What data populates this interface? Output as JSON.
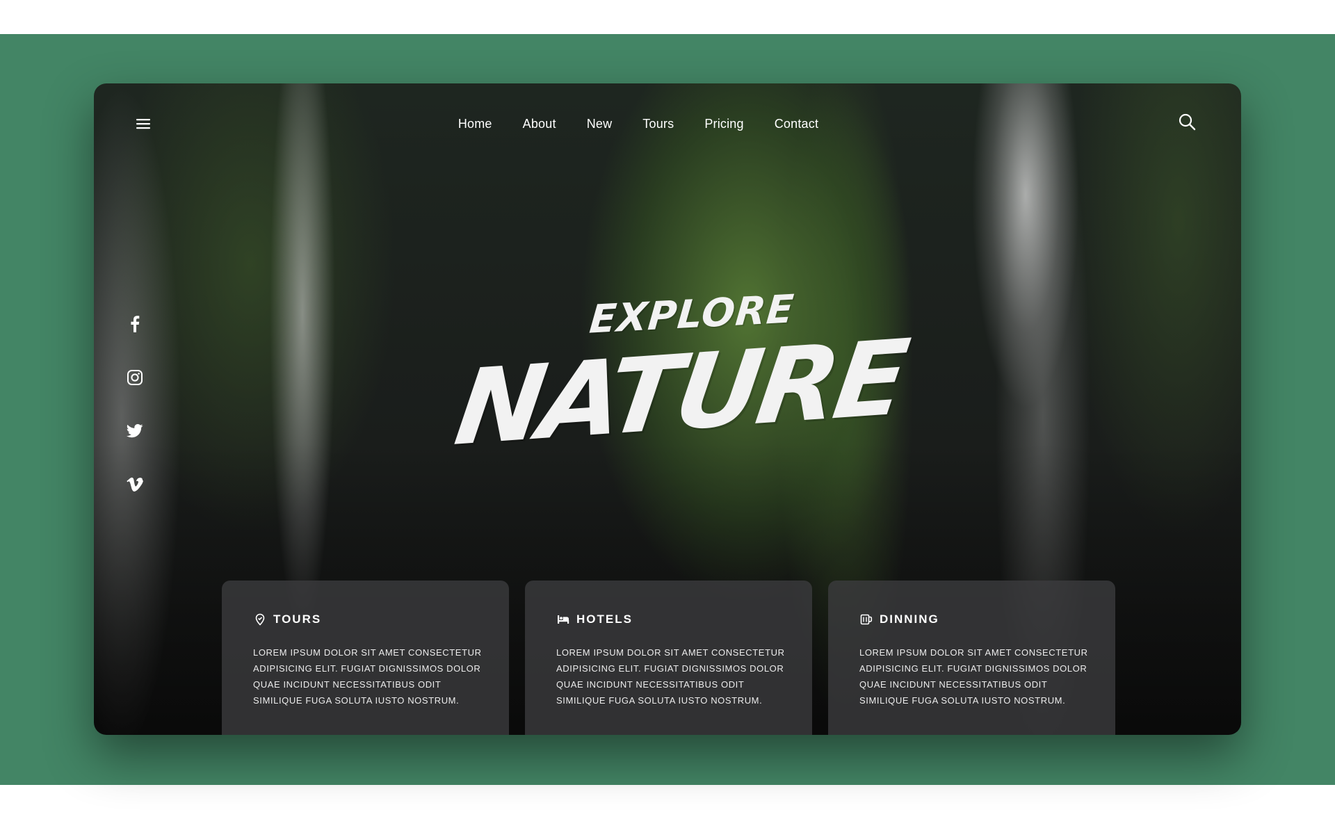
{
  "page": {
    "background_color": "#438565"
  },
  "header": {
    "menu_icon": "hamburger-menu-icon",
    "search_icon": "search-icon",
    "nav": [
      {
        "label": "Home"
      },
      {
        "label": "About"
      },
      {
        "label": "New"
      },
      {
        "label": "Tours"
      },
      {
        "label": "Pricing"
      },
      {
        "label": "Contact"
      }
    ]
  },
  "social": [
    {
      "icon": "facebook-icon"
    },
    {
      "icon": "instagram-icon"
    },
    {
      "icon": "twitter-icon"
    },
    {
      "icon": "vimeo-icon"
    }
  ],
  "hero": {
    "title_small": "EXPLORE",
    "title_big": "NATURE"
  },
  "cards": [
    {
      "icon": "location-pin-icon",
      "title": "TOURS",
      "text": "LOREM IPSUM DOLOR SIT AMET CONSECTETUR ADIPISICING ELIT. FUGIAT DIGNISSIMOS DOLOR QUAE INCIDUNT NECESSITATIBUS ODIT SIMILIQUE FUGA SOLUTA IUSTO NOSTRUM."
    },
    {
      "icon": "bed-icon",
      "title": "HOTELS",
      "text": "LOREM IPSUM DOLOR SIT AMET CONSECTETUR ADIPISICING ELIT. FUGIAT DIGNISSIMOS DOLOR QUAE INCIDUNT NECESSITATIBUS ODIT SIMILIQUE FUGA SOLUTA IUSTO NOSTRUM."
    },
    {
      "icon": "mug-icon",
      "title": "DINNING",
      "text": "LOREM IPSUM DOLOR SIT AMET CONSECTETUR ADIPISICING ELIT. FUGIAT DIGNISSIMOS DOLOR QUAE INCIDUNT NECESSITATIBUS ODIT SIMILIQUE FUGA SOLUTA IUSTO NOSTRUM."
    }
  ]
}
